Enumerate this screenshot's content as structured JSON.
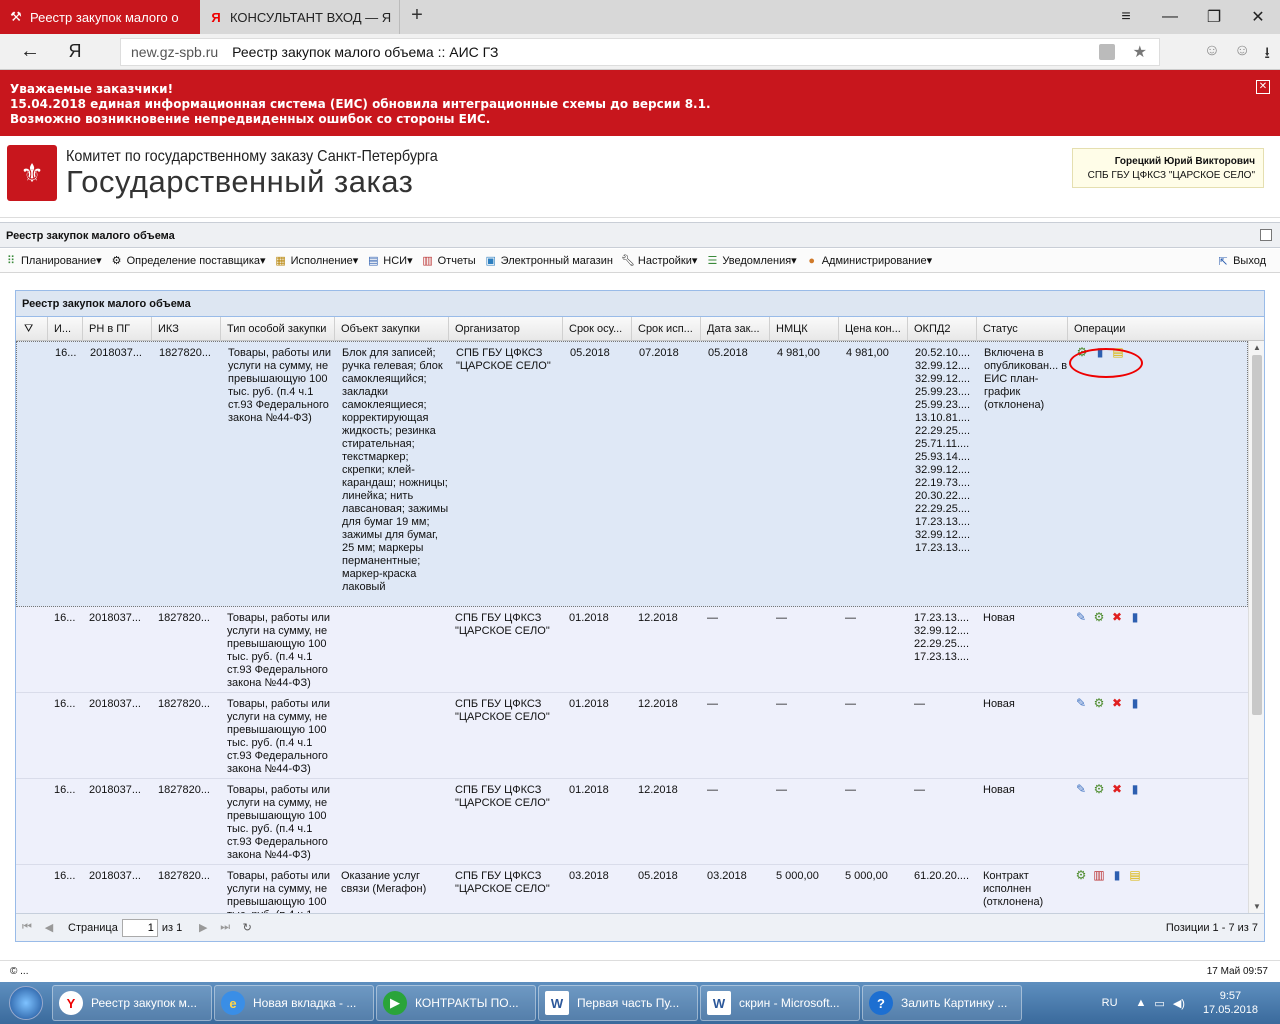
{
  "browser": {
    "tabs": [
      {
        "title": "Реестр закупок малого о",
        "active": true
      },
      {
        "title": "КОНСУЛЬТАНТ ВХОД — Ян",
        "active": false
      }
    ],
    "new_tab": "+",
    "host": "new.gz-spb.ru",
    "page_title": "Реестр закупок малого объема :: АИС ГЗ"
  },
  "notice": {
    "line1": "Уважаемые заказчики!",
    "line2": "15.04.2018 единая информационная система (ЕИС) обновила интеграционные схемы до версии 8.1.",
    "line3": "Возможно возникновение непредвиденных ошибок со стороны ЕИС."
  },
  "header": {
    "line1": "Комитет по государственному заказу Санкт-Петербурга",
    "line2": "Государственный заказ",
    "user_name": "Горецкий Юрий Викторович",
    "user_org": "СПБ ГБУ ЦФКСЗ \"ЦАРСКОЕ СЕЛО\""
  },
  "panel": {
    "title": "Реестр закупок малого объема"
  },
  "menu": {
    "items": [
      {
        "label": "Планирование",
        "dropdown": true
      },
      {
        "label": "Определение поставщика",
        "dropdown": true
      },
      {
        "label": "Исполнение",
        "dropdown": true
      },
      {
        "label": "НСИ",
        "dropdown": true
      },
      {
        "label": "Отчеты",
        "dropdown": false
      },
      {
        "label": "Электронный магазин",
        "dropdown": false
      },
      {
        "label": "Настройки",
        "dropdown": true
      },
      {
        "label": "Уведомления",
        "dropdown": true
      },
      {
        "label": "Администрирование",
        "dropdown": true
      }
    ],
    "exit": "Выход"
  },
  "grid": {
    "title": "Реестр закупок малого объема",
    "columns": [
      "И...",
      "РН в ПГ",
      "ИКЗ",
      "Тип особой закупки",
      "Объект закупки",
      "Организатор",
      "Срок осу...",
      "Срок исп...",
      "Дата зак...",
      "НМЦК",
      "Цена кон...",
      "ОКПД2",
      "Статус",
      "Операции"
    ],
    "rows": [
      {
        "id": "16...",
        "rn": "2018037...",
        "ikz": "1827820...",
        "type": "Товары, работы или услуги на сумму, не превышающую 100 тыс. руб. (п.4 ч.1 ст.93 Федерального закона №44-ФЗ)",
        "object": "Блок для записей; ручка гелевая; блок самоклеящийся; закладки самоклеящиеся; корректирующая жидкость; резинка стирательная; текстмаркер; скрепки; клей-карандаш; ножницы; линейка; нить лавсановая; зажимы для бумаг 19 мм; зажимы для бумаг, 25 мм; маркеры перманентные; маркер-краска лаковый",
        "org": "СПБ ГБУ ЦФКСЗ \"ЦАРСКОЕ СЕЛО\"",
        "s1": "05.2018",
        "s2": "07.2018",
        "date": "05.2018",
        "nmck": "4 981,00",
        "price": "4 981,00",
        "okpd": "20.52.10....\n32.99.12....\n32.99.12....\n25.99.23....\n25.99.23....\n13.10.81....\n22.29.25....\n25.71.11....\n25.93.14....\n32.99.12....\n22.19.73....\n20.30.22....\n22.29.25....\n17.23.13....\n32.99.12....\n17.23.13....",
        "status": "Включена в опубликован... в ЕИС план-график (отклонена)",
        "ops": [
          "gear",
          "chart",
          "note"
        ]
      },
      {
        "id": "16...",
        "rn": "2018037...",
        "ikz": "1827820...",
        "type": "Товары, работы или услуги на сумму, не превышающую 100 тыс. руб. (п.4 ч.1 ст.93 Федерального закона №44-ФЗ)",
        "object": "",
        "org": "СПБ ГБУ ЦФКСЗ \"ЦАРСКОЕ СЕЛО\"",
        "s1": "01.2018",
        "s2": "12.2018",
        "date": "—",
        "nmck": "—",
        "price": "—",
        "okpd": "17.23.13....\n32.99.12....\n22.29.25....\n17.23.13....",
        "status": "Новая",
        "ops": [
          "edit",
          "gear",
          "del",
          "chart"
        ]
      },
      {
        "id": "16...",
        "rn": "2018037...",
        "ikz": "1827820...",
        "type": "Товары, работы или услуги на сумму, не превышающую 100 тыс. руб. (п.4 ч.1 ст.93 Федерального закона №44-ФЗ)",
        "object": "",
        "org": "СПБ ГБУ ЦФКСЗ \"ЦАРСКОЕ СЕЛО\"",
        "s1": "01.2018",
        "s2": "12.2018",
        "date": "—",
        "nmck": "—",
        "price": "—",
        "okpd": "—",
        "status": "Новая",
        "ops": [
          "edit",
          "gear",
          "del",
          "chart"
        ]
      },
      {
        "id": "16...",
        "rn": "2018037...",
        "ikz": "1827820...",
        "type": "Товары, работы или услуги на сумму, не превышающую 100 тыс. руб. (п.4 ч.1 ст.93 Федерального закона №44-ФЗ)",
        "object": "",
        "org": "СПБ ГБУ ЦФКСЗ \"ЦАРСКОЕ СЕЛО\"",
        "s1": "01.2018",
        "s2": "12.2018",
        "date": "—",
        "nmck": "—",
        "price": "—",
        "okpd": "—",
        "status": "Новая",
        "ops": [
          "edit",
          "gear",
          "del",
          "chart"
        ]
      },
      {
        "id": "16...",
        "rn": "2018037...",
        "ikz": "1827820...",
        "type": "Товары, работы или услуги на сумму, не превышающую 100 тыс. руб. (п.4 ч.1",
        "object": "Оказание услуг связи (Мегафон)",
        "org": "СПБ ГБУ ЦФКСЗ \"ЦАРСКОЕ СЕЛО\"",
        "s1": "03.2018",
        "s2": "05.2018",
        "date": "03.2018",
        "nmck": "5 000,00",
        "price": "5 000,00",
        "okpd": "61.20.20....",
        "status": "Контракт исполнен (отклонена)",
        "ops": [
          "gear",
          "doc",
          "chart",
          "note"
        ]
      }
    ]
  },
  "pager": {
    "page_label": "Страница",
    "page_value": "1",
    "of_label": "из 1",
    "positions": "Позиции 1 - 7 из 7"
  },
  "footer": {
    "copyright": "© ...",
    "datetime": "17 Май 09:57"
  },
  "taskbar": {
    "items": [
      {
        "label": "Реестр закупок м...",
        "icon": "Y"
      },
      {
        "label": "Новая вкладка - ...",
        "icon": "e"
      },
      {
        "label": "КОНТРАКТЫ ПО...",
        "icon": "▶"
      },
      {
        "label": "Первая часть Пу...",
        "icon": "W"
      },
      {
        "label": "скрин - Microsoft...",
        "icon": "W"
      },
      {
        "label": "Залить Картинку ...",
        "icon": "?"
      }
    ],
    "lang": "RU",
    "time": "9:57",
    "date": "17.05.2018"
  },
  "colors": {
    "accent_red": "#c8161d",
    "grid_border": "#99bbe8",
    "row_bg": "#eef0fb"
  }
}
